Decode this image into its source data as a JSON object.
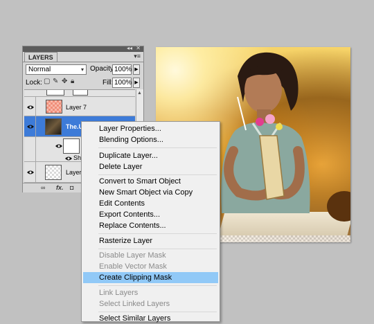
{
  "layers_panel": {
    "tab_label": "LAYERS",
    "panel_menu_icon": "panel-menu-icon",
    "blend_mode": "Normal",
    "opacity_label": "Opacity:",
    "opacity_value": "100%",
    "lock_label": "Lock:",
    "fill_label": "Fill:",
    "fill_value": "100%",
    "layers": [
      {
        "name": "Layer 7"
      },
      {
        "name": "The.U"
      },
      {
        "name": "Sha"
      },
      {
        "name": "Layer"
      }
    ]
  },
  "context_menu": {
    "items": [
      {
        "label": "Layer Properties...",
        "enabled": true
      },
      {
        "label": "Blending Options...",
        "enabled": true
      },
      {
        "label": "Duplicate Layer...",
        "enabled": true
      },
      {
        "label": "Delete Layer",
        "enabled": true
      },
      {
        "label": "Convert to Smart Object",
        "enabled": true
      },
      {
        "label": "New Smart Object via Copy",
        "enabled": true
      },
      {
        "label": "Edit Contents",
        "enabled": true
      },
      {
        "label": "Export Contents...",
        "enabled": true
      },
      {
        "label": "Replace Contents...",
        "enabled": true
      },
      {
        "label": "Rasterize Layer",
        "enabled": true
      },
      {
        "label": "Disable Layer Mask",
        "enabled": false
      },
      {
        "label": "Enable Vector Mask",
        "enabled": false
      },
      {
        "label": "Create Clipping Mask",
        "enabled": true,
        "highlighted": true
      },
      {
        "label": "Link Layers",
        "enabled": false
      },
      {
        "label": "Select Linked Layers",
        "enabled": false
      },
      {
        "label": "Select Similar Layers",
        "enabled": true
      }
    ]
  },
  "colors": {
    "selection": "#3d7bd8",
    "menu_highlight": "#91c9f7",
    "background": "#c1c1c1"
  }
}
